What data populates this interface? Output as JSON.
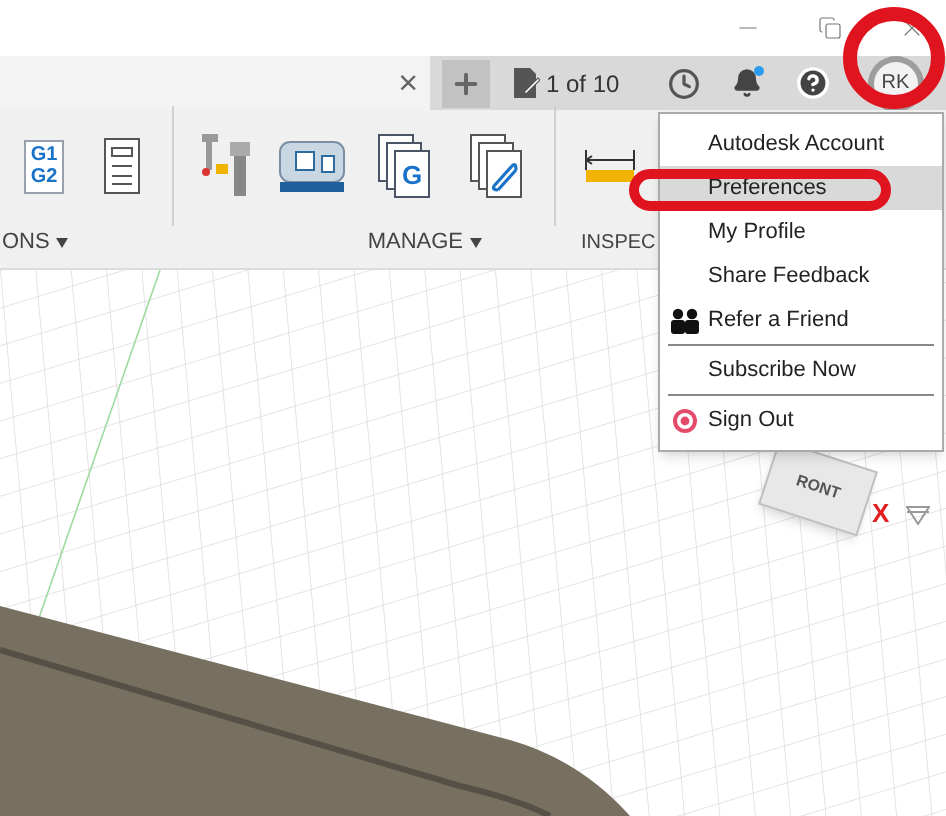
{
  "document_tab": {
    "close": "×"
  },
  "tab_bar": {
    "page_counter": "1 of 10",
    "notification": true,
    "avatar": "RK"
  },
  "toolbar": {
    "tools": [
      {
        "kind": "gcode",
        "lines": [
          "G1",
          "G2"
        ]
      },
      {
        "kind": "sheet"
      },
      {
        "kind": "divider"
      },
      {
        "kind": "mill"
      },
      {
        "kind": "machine"
      },
      {
        "kind": "doc",
        "letter": "G"
      },
      {
        "kind": "doc-clip"
      },
      {
        "kind": "divider"
      },
      {
        "kind": "ruler"
      }
    ],
    "groups": [
      {
        "label": "ONS",
        "caret": true
      },
      {
        "label": "MANAGE",
        "caret": true
      },
      {
        "label": "INSPEC",
        "caret": false
      }
    ]
  },
  "menu": {
    "items": [
      {
        "label": "Autodesk Account",
        "selected": false,
        "kind": "plain",
        "divider_before": false
      },
      {
        "label": "Preferences",
        "selected": true,
        "kind": "plain",
        "divider_before": false
      },
      {
        "label": "My Profile",
        "selected": false,
        "kind": "plain",
        "divider_before": false
      },
      {
        "label": "Share Feedback",
        "selected": false,
        "kind": "plain",
        "divider_before": false
      },
      {
        "label": "Refer a Friend",
        "selected": false,
        "kind": "people",
        "divider_before": false
      },
      {
        "label": "Subscribe Now",
        "selected": false,
        "kind": "plain",
        "divider_before": true
      },
      {
        "label": "Sign Out",
        "selected": false,
        "kind": "signout",
        "divider_before": true
      }
    ]
  },
  "view_cube": {
    "face": "RONT",
    "axis": "X"
  }
}
